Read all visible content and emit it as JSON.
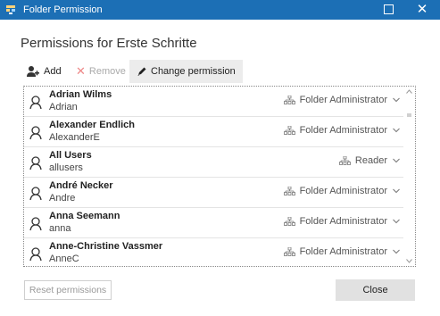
{
  "window": {
    "title": "Folder Permission",
    "maximize_label": "",
    "close_glyph": "✕"
  },
  "heading": "Permissions for Erste Schritte",
  "toolbar": {
    "add_label": "Add",
    "remove_label": "Remove",
    "change_label": "Change permission"
  },
  "users": [
    {
      "name": "Adrian Wilms",
      "login": "Adrian",
      "permission": "Folder Administrator"
    },
    {
      "name": "Alexander Endlich",
      "login": "AlexanderE",
      "permission": "Folder Administrator"
    },
    {
      "name": "All Users",
      "login": "allusers",
      "permission": "Reader"
    },
    {
      "name": "André Necker",
      "login": "Andre",
      "permission": "Folder Administrator"
    },
    {
      "name": "Anna Seemann",
      "login": "anna",
      "permission": "Folder Administrator"
    },
    {
      "name": "Anne-Christine Vassmer",
      "login": "AnneC",
      "permission": "Folder Administrator"
    }
  ],
  "footer": {
    "reset_label": "Reset permissions",
    "close_label": "Close"
  },
  "colors": {
    "titlebar": "#1c6fb5",
    "accent_remove": "#e88888"
  }
}
